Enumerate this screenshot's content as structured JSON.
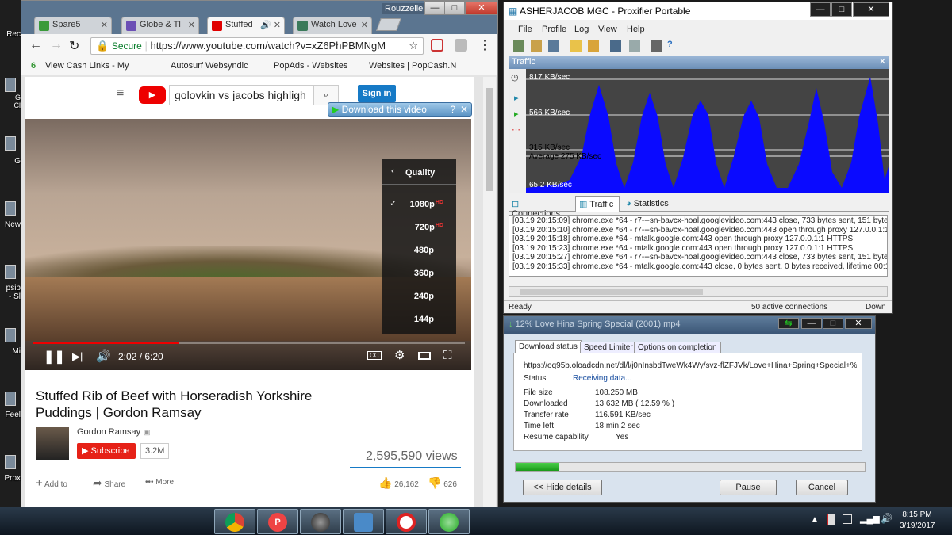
{
  "desktop": {
    "items": [
      "Rec",
      "G\nCl",
      "G",
      "New",
      "psip\n- Sl",
      "Mi",
      "Feel",
      "Prox"
    ]
  },
  "browser": {
    "tabs": [
      {
        "label": "Spare5",
        "color": "#3a9a3a"
      },
      {
        "label": "Globe & Tl",
        "color": "#6b4fb5"
      },
      {
        "label": "Stuffed",
        "color": "#e00000"
      },
      {
        "label": "Watch Love",
        "color": "#3a7a5a"
      }
    ],
    "profile": "Rouzzelle",
    "url_secure": "Secure",
    "url": "https://www.youtube.com/watch?v=xZ6PhPBMNgM",
    "bookmarks": [
      "View Cash Links - My",
      "Autosurf Websyndic",
      "PopAds - Websites",
      "Websites | PopCash.N"
    ],
    "search_query": "golovkin vs jacobs highligh",
    "sign_in": "Sign in",
    "download_bar": "Download this video",
    "quality_title": "Quality",
    "qualities": [
      "1080p",
      "720p",
      "480p",
      "360p",
      "240p",
      "144p"
    ],
    "quality_hd": "HD",
    "time": "2:02 / 6:20",
    "video_title_line1": "Stuffed Rib of Beef with Horseradish Yorkshire",
    "video_title_line2": "Puddings | Gordon Ramsay",
    "channel": "Gordon Ramsay",
    "subscribe": "Subscribe",
    "subs": "3.2M",
    "views": "2,595,590 views",
    "add_to": "Add to",
    "share": "Share",
    "more": "More",
    "likes": "26,162",
    "dislikes": "626"
  },
  "proxifier": {
    "title": "ASHERJACOB MGC - Proxifier Portable",
    "menu": [
      "File",
      "Profile",
      "Log",
      "View",
      "Help"
    ],
    "panel_title": "Traffic",
    "y_labels": [
      "817 KB/sec",
      "566 KB/sec",
      "315 KB/sec",
      "Average 275 KB/sec",
      "65.2 KB/sec"
    ],
    "tabs": [
      "Connections",
      "Traffic",
      "Statistics"
    ],
    "log": [
      "[03.19 20:15:09] chrome.exe *64 - r7---sn-bavcx-hoal.googlevideo.com:443 close, 733 bytes sent, 151 bytes re",
      "[03.19 20:15:10] chrome.exe *64 - r7---sn-bavcx-hoal.googlevideo.com:443 open through proxy 127.0.0.1:1 HT",
      "[03.19 20:15:18] chrome.exe *64 - mtalk.google.com:443 open through proxy 127.0.0.1:1 HTTPS",
      "[03.19 20:15:23] chrome.exe *64 - mtalk.google.com:443 open through proxy 127.0.0.1:1 HTTPS",
      "[03.19 20:15:27] chrome.exe *64 - r7---sn-bavcx-hoal.googlevideo.com:443 close, 733 bytes sent, 151 bytes re",
      "[03.19 20:15:33] chrome.exe *64 - mtalk.google.com:443 close, 0 bytes sent, 0 bytes received, lifetime 00:10"
    ],
    "status_left": "Ready",
    "status_mid": "50 active connections",
    "status_right": "Down"
  },
  "download": {
    "title": "12% Love Hina Spring Special (2001).mp4",
    "tabs": [
      "Download status",
      "Speed Limiter",
      "Options on completion"
    ],
    "url": "https://oq95b.oloadcdn.net/dl/l/j0nInsbdTweWk4Wy/svz-flZFJVk/Love+Hina+Spring+Special+%2",
    "rows": [
      {
        "label": "Status",
        "value": "Receiving data..."
      },
      {
        "label": "File size",
        "value": "108.250  MB"
      },
      {
        "label": "Downloaded",
        "value": "13.632  MB  ( 12.59 % )"
      },
      {
        "label": "Transfer rate",
        "value": "116.591  KB/sec"
      },
      {
        "label": "Time left",
        "value": "18 min 2 sec"
      },
      {
        "label": "Resume capability",
        "value": "Yes"
      }
    ],
    "progress_fraction": 0.1259,
    "hide_details": "<< Hide details",
    "pause": "Pause",
    "cancel": "Cancel"
  },
  "taskbar": {
    "apps": [
      "chrome-icon",
      "popcash-icon",
      "globe-icon",
      "network-icon",
      "block-icon",
      "downloader-icon"
    ],
    "time": "8:15 PM",
    "date": "3/19/2017"
  }
}
